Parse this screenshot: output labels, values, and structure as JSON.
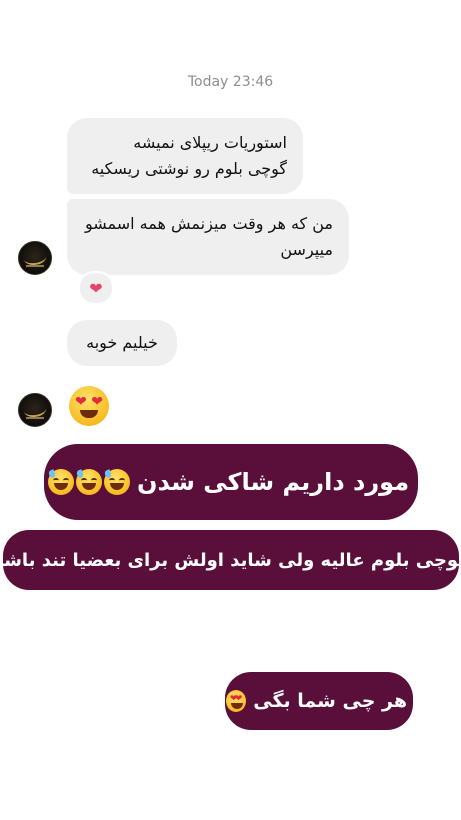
{
  "chat": {
    "timestamp": "Today 23:46",
    "messages": [
      {
        "text": "استوریات ریپلای نمیشه\nگوچی بلوم رو نوشتی ریسکیه"
      },
      {
        "text": "من که هر وقت میزنمش همه اسمشو\nمیپرسن"
      },
      {
        "text": "خیلیم خوبه"
      }
    ],
    "reaction": "heart",
    "big_emoji": "heart-eyes-face"
  },
  "banners": [
    {
      "text": "مورد داریم شاکی شدن",
      "emoji": "sweat-smile-face"
    },
    {
      "text": "گوچی بلوم عالیه ولی شاید اولش برای بعضیا تند باشه"
    },
    {
      "text": "هر چی شما بگی",
      "emoji": "heart-eyes-face"
    }
  ],
  "colors": {
    "banner_bg": "#5a0f3a",
    "bubble_bg": "#efefef",
    "timestamp": "#8e8e8e"
  }
}
